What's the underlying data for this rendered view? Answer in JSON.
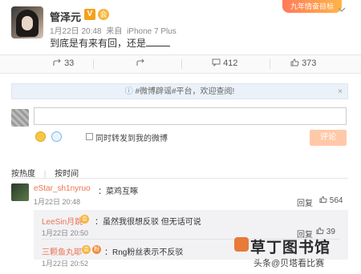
{
  "post": {
    "username": "管泽元",
    "verified_badge": "V",
    "vip_badge": "会",
    "date": "1月22日 20:48",
    "source_prefix": "来自",
    "source": "iPhone 7 Plus",
    "text": "到底是有来有回，还是",
    "banner_text": "九年情奋目标",
    "dropdown_icon": "chevron-down-icon"
  },
  "actions": {
    "forward_count": "33",
    "comment_count": "412",
    "like_count": "373"
  },
  "hot_banner": {
    "text": "#微博辟谣#平台，欢迎查阅!",
    "close": "×"
  },
  "comment_form": {
    "input_value": "",
    "forward_label": "同时转发到我的微博",
    "submit_label": "评论"
  },
  "sort_tabs": [
    "按热度",
    "按时间"
  ],
  "comments": [
    {
      "name": "eStar_sh1nyruo",
      "text": "：菜鸡互啄",
      "time": "1月22日 20:48",
      "reply_label": "回复",
      "likes": "564"
    }
  ],
  "replies": [
    {
      "name": "LeeSin月跳",
      "text": "：虽然我很想反驳 但无话可说",
      "time": "1月22日 20:50",
      "reply_label": "回复",
      "likes": "39"
    },
    {
      "name": "三颗鱼丸耶",
      "text": "：Rng粉丝表示不反驳",
      "time": "1月22日 20:52",
      "reply_label": "回复",
      "likes": ""
    }
  ],
  "watermark": {
    "title": "草丁图书馆",
    "subtitle": "头条@贝塔看比赛"
  },
  "colors": {
    "accent_orange": "#eb7350",
    "submit_disabled": "#ffc9a8",
    "hot_banner_bg": "#eaf1f8",
    "reply_bg": "#f2f2f5"
  }
}
